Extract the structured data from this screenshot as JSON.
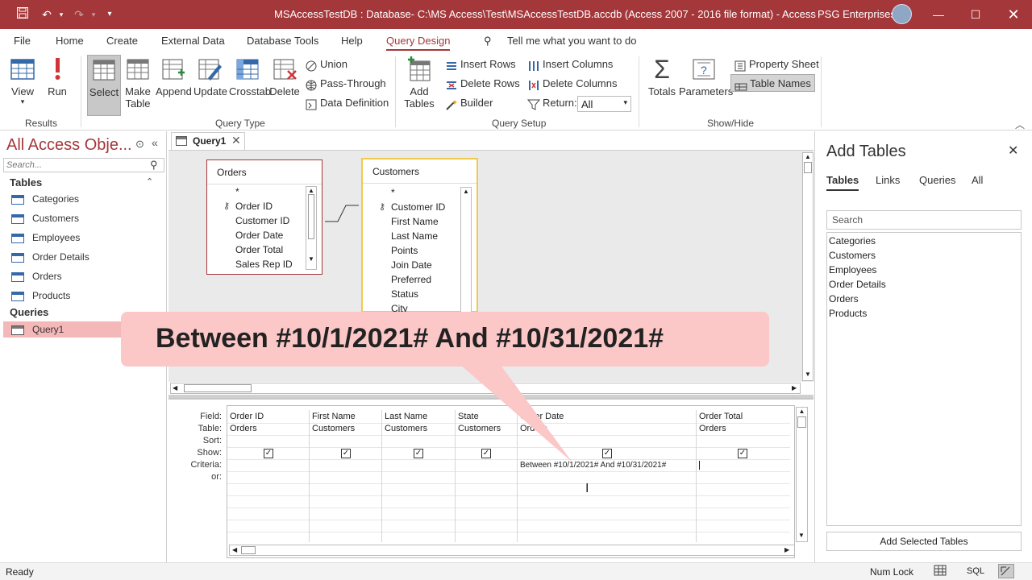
{
  "titlebar": {
    "title": "MSAccessTestDB : Database- C:\\MS Access\\Test\\MSAccessTestDB.accdb (Access 2007 - 2016 file format) - Access",
    "user": "PSG Enterprises",
    "icons": [
      "save-icon",
      "undo-icon",
      "redo-icon",
      "customize-icon",
      "minimize-icon",
      "maximize-icon",
      "close-icon"
    ]
  },
  "tabs": [
    "File",
    "Home",
    "Create",
    "External Data",
    "Database Tools",
    "Help",
    "Query Design"
  ],
  "tell_me": "Tell me what you want to do",
  "ribbon": {
    "results": {
      "group": "Results",
      "view": "View",
      "run": "Run"
    },
    "query_type": {
      "group": "Query Type",
      "select": "Select",
      "make_table_1": "Make",
      "make_table_2": "Table",
      "append": "Append",
      "update": "Update",
      "crosstab": "Crosstab",
      "delete": "Delete",
      "union": "Union",
      "pass_through": "Pass-Through",
      "data_definition": "Data Definition"
    },
    "query_setup": {
      "group": "Query Setup",
      "add_tables_1": "Add",
      "add_tables_2": "Tables",
      "insert_rows": "Insert Rows",
      "delete_rows": "Delete Rows",
      "builder": "Builder",
      "insert_columns": "Insert Columns",
      "delete_columns": "Delete Columns",
      "return_label": "Return:",
      "return_value": "All"
    },
    "show_hide": {
      "group": "Show/Hide",
      "totals": "Totals",
      "parameters": "Parameters",
      "property_sheet": "Property Sheet",
      "table_names": "Table Names"
    }
  },
  "nav": {
    "title": "All Access Obje...",
    "search_placeholder": "Search...",
    "tables_header": "Tables",
    "tables": [
      "Categories",
      "Customers",
      "Employees",
      "Order Details",
      "Orders",
      "Products"
    ],
    "queries_header": "Queries",
    "queries": [
      "Query1"
    ]
  },
  "doc_tab": "Query1",
  "design": {
    "orders": {
      "title": "Orders",
      "fields": [
        "*",
        "Order ID",
        "Customer ID",
        "Order Date",
        "Order Total",
        "Sales Rep ID"
      ]
    },
    "customers": {
      "title": "Customers",
      "fields": [
        "*",
        "Customer ID",
        "First Name",
        "Last Name",
        "Points",
        "Join Date",
        "Preferred",
        "Status",
        "City"
      ]
    }
  },
  "callout": "Between #10/1/2021# And #10/31/2021#",
  "grid": {
    "row_labels": [
      "Field:",
      "Table:",
      "Sort:",
      "Show:",
      "Criteria:",
      "or:"
    ],
    "columns": [
      {
        "field": "Order ID",
        "table": "Orders",
        "show": true,
        "criteria": ""
      },
      {
        "field": "First Name",
        "table": "Customers",
        "show": true,
        "criteria": ""
      },
      {
        "field": "Last Name",
        "table": "Customers",
        "show": true,
        "criteria": ""
      },
      {
        "field": "State",
        "table": "Customers",
        "show": true,
        "criteria": ""
      },
      {
        "field": "Order Date",
        "table": "Orders",
        "show": true,
        "criteria": "Between #10/1/2021# And #10/31/2021#"
      },
      {
        "field": "Order Total",
        "table": "Orders",
        "show": true,
        "criteria": ""
      }
    ]
  },
  "add_tables": {
    "title": "Add Tables",
    "tabs": [
      "Tables",
      "Links",
      "Queries",
      "All"
    ],
    "search_placeholder": "Search",
    "items": [
      "Categories",
      "Customers",
      "Employees",
      "Order Details",
      "Orders",
      "Products"
    ],
    "button": "Add Selected Tables"
  },
  "status": {
    "left": "Ready",
    "num_lock": "Num Lock",
    "sql": "SQL"
  }
}
